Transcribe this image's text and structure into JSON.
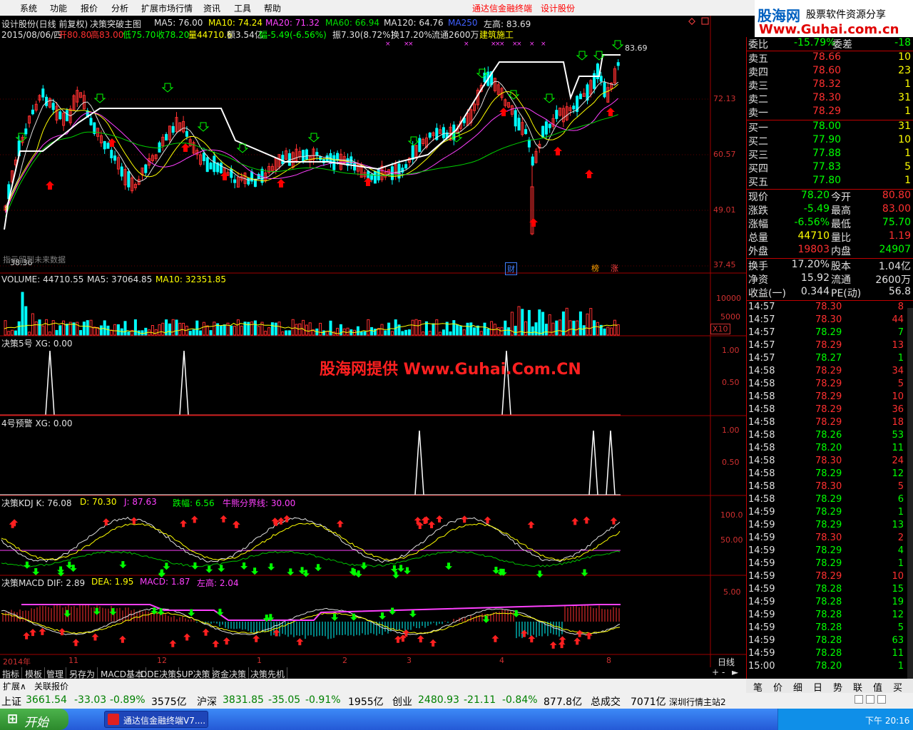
{
  "menu": {
    "items": [
      "系统",
      "功能",
      "报价",
      "分析",
      "扩展市场行情",
      "资讯",
      "工具",
      "帮助"
    ],
    "center_title": "通达信金融终端",
    "center_stock": "设计股份"
  },
  "logo": {
    "top": "股海网",
    "top2": "股票软件资源分享",
    "url": "Www.Guhai.com.cn"
  },
  "main_chart": {
    "header1": "设计股份(日线 前复权)",
    "header_indicator": "决策突破主图",
    "ma5": "MA5: 76.00",
    "ma10": "MA10: 74.24",
    "ma20": "MA20: 71.32",
    "ma60": "MA60: 66.94",
    "ma120": "MA120: 64.76",
    "ma250": "MA250",
    "left_high": "左高: 83.69",
    "info_date": "2015/08/06/四",
    "info_open": "开80.80",
    "info_high": "高83.00",
    "info_low": "低75.70",
    "info_close": "收78.20",
    "info_vol": "量44710.6",
    "info_amt": "额3.54亿",
    "info_chg": "幅-5.49(-6.56%)",
    "info_amp": "振7.30(8.72%)",
    "info_turn": "换17.20%",
    "info_float": "流通2600万",
    "info_industry": "建筑施工",
    "price_high_label": "83.69",
    "price_low_label": "38.36",
    "future_label": "指示留到未来数据",
    "axis": [
      "72.13",
      "60.57",
      "49.01",
      "37.45"
    ],
    "tags": [
      "财",
      "榜",
      "涨"
    ]
  },
  "volume": {
    "label": "VOLUME: 44710.55",
    "ma5": "MA5: 37064.85",
    "ma10": "MA10: 32351.85",
    "axis": [
      "10000",
      "5000"
    ],
    "x10": "X10"
  },
  "ind5": {
    "label": "决策5号  XG: 0.00",
    "axis": [
      "1.00",
      "0.50"
    ]
  },
  "ind4": {
    "label": "4号预警  XG: 0.00",
    "axis": [
      "1.00",
      "0.50"
    ]
  },
  "kdj": {
    "label": "决策KDJ  K: 76.08",
    "d": "D: 70.30",
    "j": "J: 87.63",
    "fall": "跌幅: 6.56",
    "bull": "牛熊分界线: 30.00",
    "axis": [
      "100.0",
      "50.00"
    ]
  },
  "macd": {
    "label": "决策MACD  DIF: 2.89",
    "dea": "DEA: 1.95",
    "macd": "MACD: 1.87",
    "lh": "左高: 2.04",
    "axis": [
      "5.00"
    ]
  },
  "watermark": "股海网提供  Www.Guhai.Com.CN",
  "time_axis": [
    "2014年",
    "11",
    "12",
    "1",
    "2",
    "3",
    "4",
    "8"
  ],
  "period": "日线",
  "bottom_tabs": [
    "指标",
    "模板",
    "管理",
    "另存为",
    "MACD基本",
    "DDE决策",
    "SUP决策",
    "资金决策",
    "决策先机"
  ],
  "sub_tabs": [
    "扩展∧",
    "关联报价"
  ],
  "quote": {
    "weibi_label": "委比",
    "weibi_val": "-15.79%",
    "weicha_label": "委差",
    "weicha_val": "-18",
    "asks": [
      {
        "label": "卖五",
        "price": "78.66",
        "vol": "10"
      },
      {
        "label": "卖四",
        "price": "78.60",
        "vol": "23"
      },
      {
        "label": "卖三",
        "price": "78.32",
        "vol": "1"
      },
      {
        "label": "卖二",
        "price": "78.30",
        "vol": "31"
      },
      {
        "label": "卖一",
        "price": "78.29",
        "vol": "1"
      }
    ],
    "bids": [
      {
        "label": "买一",
        "price": "78.00",
        "vol": "31"
      },
      {
        "label": "买二",
        "price": "77.90",
        "vol": "10"
      },
      {
        "label": "买三",
        "price": "77.88",
        "vol": "1"
      },
      {
        "label": "买四",
        "price": "77.83",
        "vol": "5"
      },
      {
        "label": "买五",
        "price": "77.80",
        "vol": "1"
      }
    ],
    "stats": [
      {
        "l1": "现价",
        "v1": "78.20",
        "l2": "今开",
        "v2": "80.80",
        "c1": "#00ff00",
        "c2": "#ff3030"
      },
      {
        "l1": "涨跌",
        "v1": "-5.49",
        "l2": "最高",
        "v2": "83.00",
        "c1": "#00ff00",
        "c2": "#ff3030"
      },
      {
        "l1": "涨幅",
        "v1": "-6.56%",
        "l2": "最低",
        "v2": "75.70",
        "c1": "#00ff00",
        "c2": "#00ff00"
      },
      {
        "l1": "总量",
        "v1": "44710",
        "l2": "量比",
        "v2": "1.19",
        "c1": "#ffff00",
        "c2": "#ff3030"
      },
      {
        "l1": "外盘",
        "v1": "19803",
        "l2": "内盘",
        "v2": "24907",
        "c1": "#ff3030",
        "c2": "#00ff00"
      }
    ],
    "stats2": [
      {
        "l1": "换手",
        "v1": "17.20%",
        "l2": "股本",
        "v2": "1.04亿"
      },
      {
        "l1": "净资",
        "v1": "15.92",
        "l2": "流通",
        "v2": "2600万"
      },
      {
        "l1": "收益(一)",
        "v1": "0.344",
        "l2": "PE(动)",
        "v2": "56.8"
      }
    ],
    "ticks": [
      {
        "t": "14:57",
        "p": "78.30",
        "v": "8",
        "c": "#ff3030"
      },
      {
        "t": "14:57",
        "p": "78.30",
        "v": "44",
        "c": "#ff3030"
      },
      {
        "t": "14:57",
        "p": "78.29",
        "v": "7",
        "c": "#00ff00"
      },
      {
        "t": "14:57",
        "p": "78.29",
        "v": "13",
        "c": "#ff3030"
      },
      {
        "t": "14:57",
        "p": "78.27",
        "v": "1",
        "c": "#00ff00"
      },
      {
        "t": "14:58",
        "p": "78.29",
        "v": "34",
        "c": "#ff3030"
      },
      {
        "t": "14:58",
        "p": "78.29",
        "v": "5",
        "c": "#ff3030"
      },
      {
        "t": "14:58",
        "p": "78.29",
        "v": "10",
        "c": "#ff3030"
      },
      {
        "t": "14:58",
        "p": "78.29",
        "v": "36",
        "c": "#ff3030"
      },
      {
        "t": "14:58",
        "p": "78.29",
        "v": "18",
        "c": "#ff3030"
      },
      {
        "t": "14:58",
        "p": "78.26",
        "v": "53",
        "c": "#00ff00"
      },
      {
        "t": "14:58",
        "p": "78.20",
        "v": "11",
        "c": "#00ff00"
      },
      {
        "t": "14:58",
        "p": "78.30",
        "v": "24",
        "c": "#ff3030"
      },
      {
        "t": "14:58",
        "p": "78.29",
        "v": "12",
        "c": "#00ff00"
      },
      {
        "t": "14:58",
        "p": "78.30",
        "v": "5",
        "c": "#ff3030"
      },
      {
        "t": "14:58",
        "p": "78.29",
        "v": "6",
        "c": "#00ff00"
      },
      {
        "t": "14:59",
        "p": "78.29",
        "v": "1",
        "c": "#00ff00"
      },
      {
        "t": "14:59",
        "p": "78.29",
        "v": "13",
        "c": "#00ff00"
      },
      {
        "t": "14:59",
        "p": "78.30",
        "v": "2",
        "c": "#ff3030"
      },
      {
        "t": "14:59",
        "p": "78.29",
        "v": "4",
        "c": "#00ff00"
      },
      {
        "t": "14:59",
        "p": "78.29",
        "v": "1",
        "c": "#00ff00"
      },
      {
        "t": "14:59",
        "p": "78.29",
        "v": "10",
        "c": "#ff3030"
      },
      {
        "t": "14:59",
        "p": "78.28",
        "v": "15",
        "c": "#00ff00"
      },
      {
        "t": "14:59",
        "p": "78.28",
        "v": "19",
        "c": "#00ff00"
      },
      {
        "t": "14:59",
        "p": "78.28",
        "v": "12",
        "c": "#00ff00"
      },
      {
        "t": "14:59",
        "p": "78.28",
        "v": "5",
        "c": "#00ff00"
      },
      {
        "t": "14:59",
        "p": "78.28",
        "v": "63",
        "c": "#00ff00"
      },
      {
        "t": "14:59",
        "p": "78.28",
        "v": "11",
        "c": "#00ff00"
      },
      {
        "t": "15:00",
        "p": "78.20",
        "v": "1",
        "c": "#00ff00"
      }
    ],
    "tabs": [
      "笔",
      "价",
      "细",
      "日",
      "势",
      "联",
      "值",
      "买"
    ]
  },
  "status": {
    "sh_label": "上证",
    "sh_val": "3661.54",
    "sh_chg": "-33.03",
    "sh_pct": "-0.89%",
    "sh_amt": "3575亿",
    "hs_label": "沪深",
    "hs_val": "3831.85",
    "hs_chg": "-35.05",
    "hs_pct": "-0.91%",
    "hs_amt": "1955亿",
    "cy_label": "创业",
    "cy_val": "2480.93",
    "cy_chg": "-21.11",
    "cy_pct": "-0.84%",
    "cy_amt": "877.8亿",
    "total_label": "总成交",
    "total_val": "7071亿",
    "server": "深圳行情主站2"
  },
  "taskbar": {
    "start": "开始",
    "app": "通达信金融终端V7....",
    "time": "下午 20:16"
  }
}
